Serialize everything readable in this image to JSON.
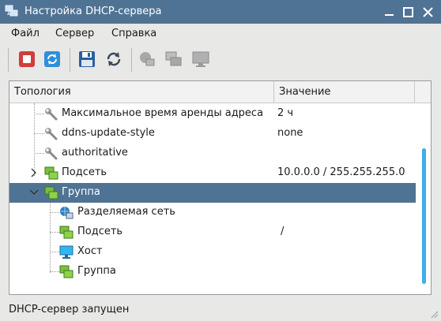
{
  "window": {
    "title": "Настройка DHCP-сервера"
  },
  "menu": [
    "Файл",
    "Сервер",
    "Справка"
  ],
  "toolbar": {
    "buttons": [
      "stop-server",
      "restart-server",
      "save",
      "reload",
      "add-network",
      "add-group",
      "add-host"
    ]
  },
  "tree": {
    "columns": [
      "Топология",
      "Значение"
    ],
    "rows": [
      {
        "label": "Максимальное время аренды адреса",
        "value": "2 ч",
        "icon": "wrench-icon"
      },
      {
        "label": "ddns-update-style",
        "value": "none",
        "icon": "wrench-icon"
      },
      {
        "label": "authoritative",
        "value": "",
        "icon": "wrench-icon"
      },
      {
        "label": "Подсеть",
        "value": "10.0.0.0 / 255.255.255.0",
        "icon": "subnet-icon",
        "expander": "collapsed"
      },
      {
        "label": "Группа",
        "value": "",
        "icon": "group-icon",
        "expander": "expanded",
        "selected": true
      },
      {
        "label": "Разделяемая сеть",
        "value": "",
        "icon": "shared-network-icon"
      },
      {
        "label": "Подсеть",
        "value": "/",
        "icon": "subnet-icon"
      },
      {
        "label": "Хост",
        "value": "",
        "icon": "host-icon"
      },
      {
        "label": "Группа",
        "value": "",
        "icon": "group-icon"
      }
    ]
  },
  "status": {
    "text": "DHCP-сервер запущен"
  },
  "colors": {
    "titlebar": "#4f7394",
    "selection": "#4f7394",
    "scroll_thumb": "#3daee9",
    "stop_red": "#d23c3c",
    "restart_blue": "#2f8fd8"
  }
}
